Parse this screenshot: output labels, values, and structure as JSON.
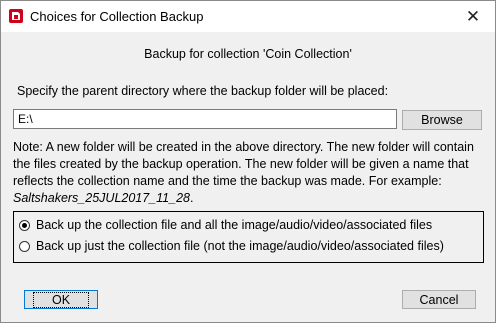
{
  "window": {
    "title": "Choices for Collection Backup",
    "close_glyph": "✕"
  },
  "heading": "Backup for collection 'Coin Collection'",
  "prompt": "Specify the parent directory where the backup folder will be placed:",
  "directory": {
    "value": "E:\\"
  },
  "browse_label": "Browse",
  "note": {
    "text": "Note: A new folder will be created in the above directory. The new folder will contain the files created by the backup operation. The new folder will be given a name that reflects the collection name and the time the backup was made. For example: ",
    "example": "Saltshakers_25JUL2017_11_28",
    "suffix": "."
  },
  "options": [
    {
      "label": "Back up the collection file and all the image/audio/video/associated files",
      "selected": true
    },
    {
      "label": "Back up just the collection file (not the image/audio/video/associated files)",
      "selected": false
    }
  ],
  "buttons": {
    "ok": "OK",
    "cancel": "Cancel"
  },
  "icons": {
    "app": "app-icon",
    "close": "close-icon"
  },
  "colors": {
    "focus": "#0078d7",
    "app_icon": "#d0021b"
  }
}
